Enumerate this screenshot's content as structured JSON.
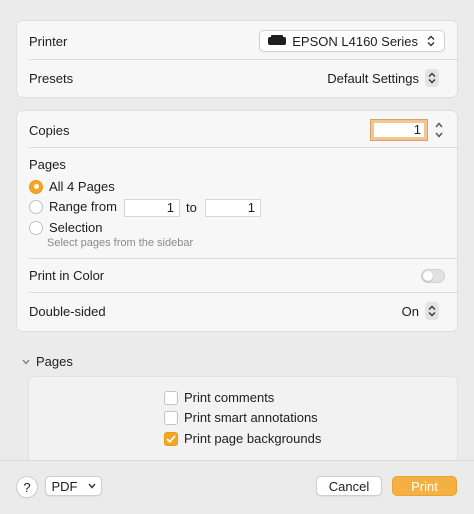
{
  "printer": {
    "label": "Printer",
    "value": "EPSON L4160 Series",
    "icon": "printer-icon"
  },
  "presets": {
    "label": "Presets",
    "value": "Default Settings"
  },
  "copies": {
    "label": "Copies",
    "value": "1"
  },
  "pages": {
    "label": "Pages",
    "options": [
      {
        "label": "All 4 Pages",
        "selected": true
      },
      {
        "label": "Range from",
        "selected": false
      },
      {
        "label": "Selection",
        "selected": false
      }
    ],
    "range_from": "1",
    "range_to_label": "to",
    "range_to": "1",
    "selection_hint": "Select pages from the sidebar"
  },
  "print_in_color": {
    "label": "Print in Color",
    "on": false
  },
  "double_sided": {
    "label": "Double-sided",
    "value": "On"
  },
  "pages_section": {
    "title": "Pages",
    "checkboxes": [
      {
        "label": "Print comments",
        "checked": false
      },
      {
        "label": "Print smart annotations",
        "checked": false
      },
      {
        "label": "Print page backgrounds",
        "checked": true
      }
    ]
  },
  "footer": {
    "help": "?",
    "pdf": "PDF",
    "cancel": "Cancel",
    "print": "Print"
  },
  "colors": {
    "accent": "#f5a623",
    "primary_button": "#f5b042"
  }
}
